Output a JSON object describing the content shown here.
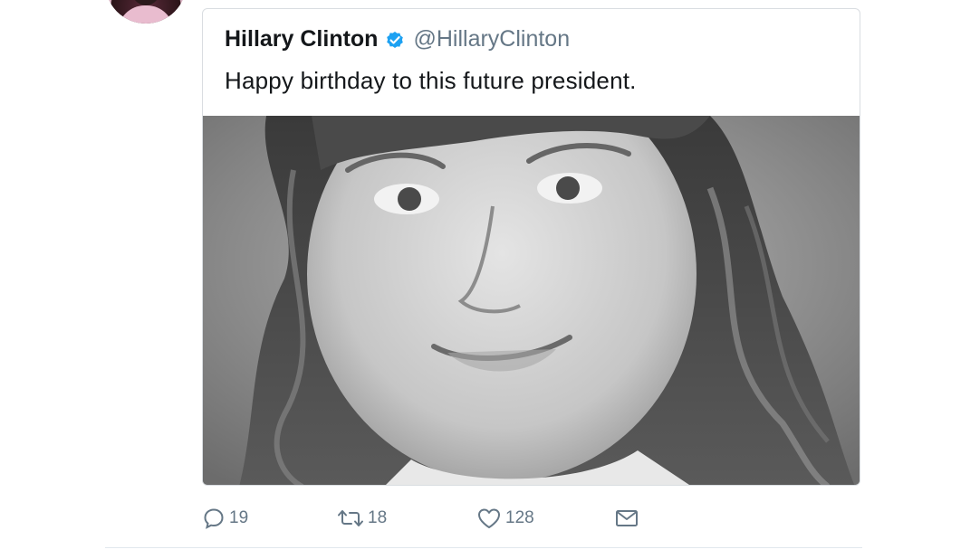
{
  "tweet": {
    "quoted": {
      "display_name": "Hillary Clinton",
      "handle": "@HillaryClinton",
      "verified_icon": "verified-badge-icon",
      "text": "Happy birthday to this future president.",
      "photo": "grayscale childhood portrait photo"
    },
    "actions": {
      "reply_icon": "reply-icon",
      "reply_count": "19",
      "retweet_icon": "retweet-icon",
      "retweet_count": "18",
      "like_icon": "heart-icon",
      "like_count": "128",
      "dm_icon": "envelope-icon"
    }
  },
  "colors": {
    "verified_blue": "#1da1f2",
    "secondary_text": "#657786",
    "primary_text": "#14171a",
    "border": "#d9dde1"
  }
}
